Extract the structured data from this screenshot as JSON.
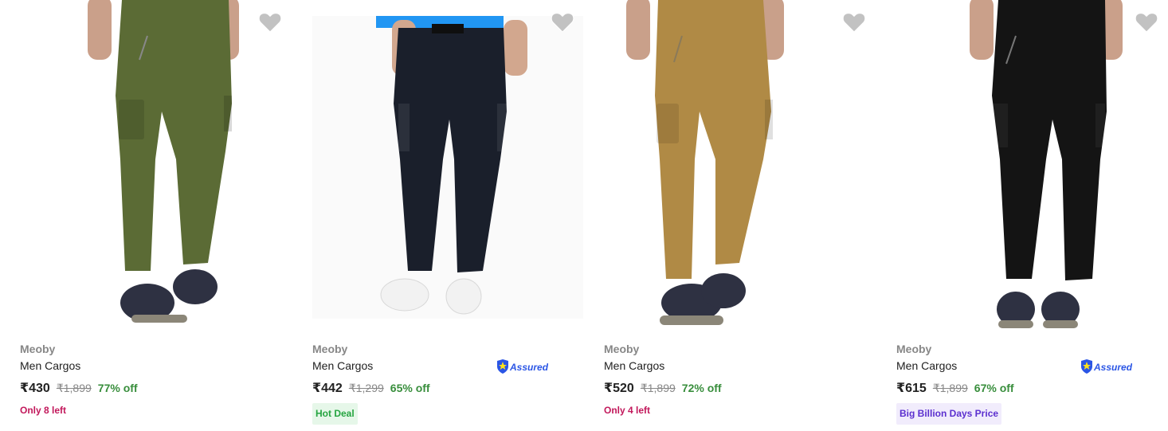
{
  "products": [
    {
      "brand": "Meoby",
      "title": "Men Cargos",
      "price": "₹430",
      "mrp": "₹1,899",
      "discount": "77% off",
      "stock_note": "Only 8 left",
      "badge": "",
      "assured": false,
      "pant_color": "#5b6b35",
      "image_icon": "olive-cargo-pants-image"
    },
    {
      "brand": "Meoby",
      "title": "Men Cargos",
      "price": "₹442",
      "mrp": "₹1,299",
      "discount": "65% off",
      "stock_note": "",
      "badge": "Hot Deal",
      "assured": true,
      "pant_color": "#1a1f2b",
      "image_icon": "navy-cargo-pants-image"
    },
    {
      "brand": "Meoby",
      "title": "Men Cargos",
      "price": "₹520",
      "mrp": "₹1,899",
      "discount": "72% off",
      "stock_note": "Only 4 left",
      "badge": "",
      "assured": false,
      "pant_color": "#b08a45",
      "image_icon": "khaki-cargo-pants-image"
    },
    {
      "brand": "Meoby",
      "title": "Men Cargos",
      "price": "₹615",
      "mrp": "₹1,899",
      "discount": "67% off",
      "stock_note": "",
      "badge": "Big Billion Days Price",
      "assured": true,
      "pant_color": "#141414",
      "image_icon": "black-cargo-pants-image"
    }
  ],
  "assured_label": "Assured",
  "colors": {
    "discount_green": "#388e3c",
    "stock_pink": "#c2185b",
    "hot_deal_bg": "#e6f7e9",
    "hot_deal_text": "#26a541",
    "bbd_bg": "#f1ecfc",
    "bbd_text": "#5b2fcf",
    "wishlist_gray": "#c2c2c2",
    "assured_blue": "#2a55e5"
  }
}
